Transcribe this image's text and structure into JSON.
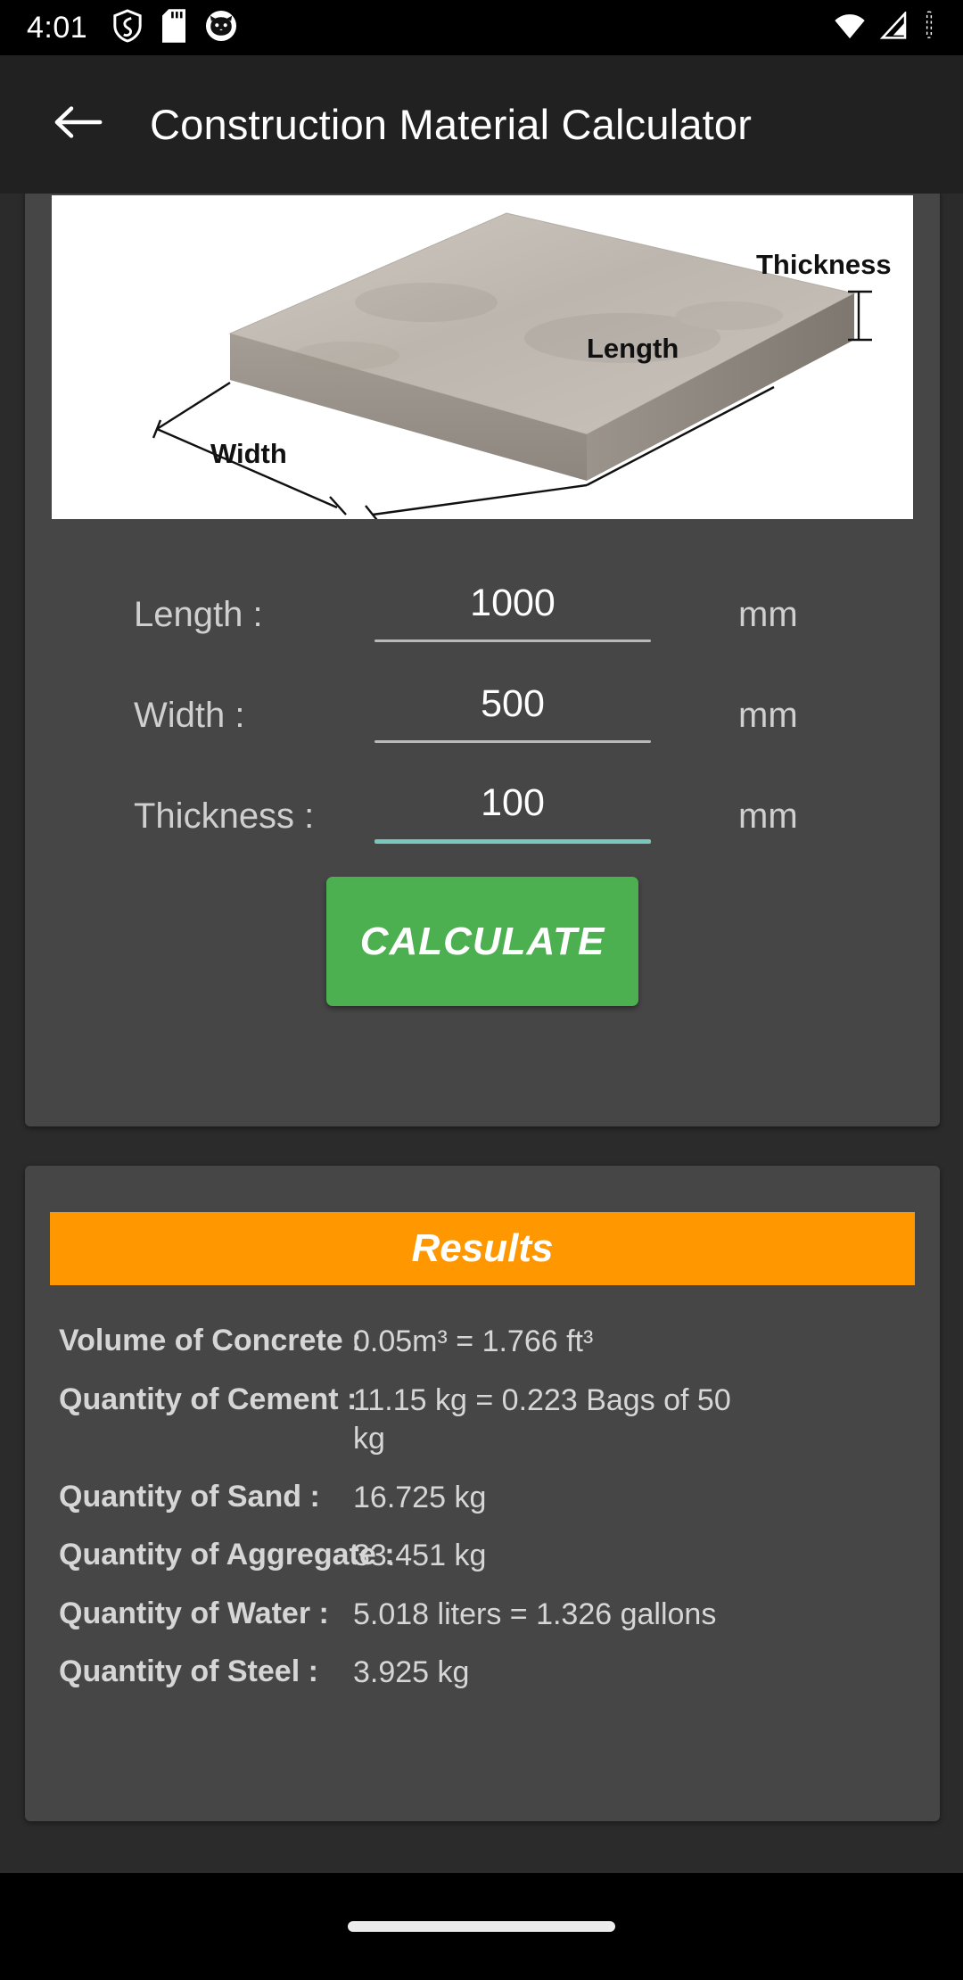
{
  "status_bar": {
    "time": "4:01",
    "left_icons": [
      "shield-icon",
      "sd-card-icon",
      "cat-avatar-icon"
    ],
    "right_icons": [
      "wifi-icon",
      "cellular-signal-icon",
      "battery-icon"
    ]
  },
  "app_bar": {
    "back_icon": "back-arrow-icon",
    "title": "Construction Material Calculator"
  },
  "diagram": {
    "alt": "concrete-slab-diagram",
    "labels": {
      "thickness": "Thickness",
      "length": "Length",
      "width": "Width"
    }
  },
  "form": {
    "fields": [
      {
        "label": "Length :",
        "value": "1000",
        "unit": "mm",
        "focused": false,
        "name": "length"
      },
      {
        "label": "Width :",
        "value": "500",
        "unit": "mm",
        "focused": false,
        "name": "width"
      },
      {
        "label": "Thickness :",
        "value": "100",
        "unit": "mm",
        "focused": true,
        "name": "thickness"
      }
    ],
    "calculate_label": "CALCULATE"
  },
  "results": {
    "header": "Results",
    "rows": [
      {
        "label": "Volume of Concrete :",
        "value": "0.05m³ = 1.766 ft³"
      },
      {
        "label": "Quantity of Cement :",
        "value": "11.15 kg = 0.223 Bags of 50 kg"
      },
      {
        "label": "Quantity of Sand :",
        "value": "16.725 kg"
      },
      {
        "label": "Quantity of Aggregate :",
        "value": " 33.451 kg"
      },
      {
        "label": "Quantity of Water :",
        "value": "5.018 liters = 1.326 gallons"
      },
      {
        "label": "Quantity of Steel :",
        "value": "3.925 kg"
      }
    ]
  },
  "nav": {
    "pill": "gesture-home-pill"
  },
  "colors": {
    "page_background": "#2b2b2b",
    "card_background": "#464646",
    "app_bar": "#212121",
    "accent_calculate": "#4caf50",
    "accent_results": "#ff9800",
    "focused_underline": "#79c6bd"
  }
}
